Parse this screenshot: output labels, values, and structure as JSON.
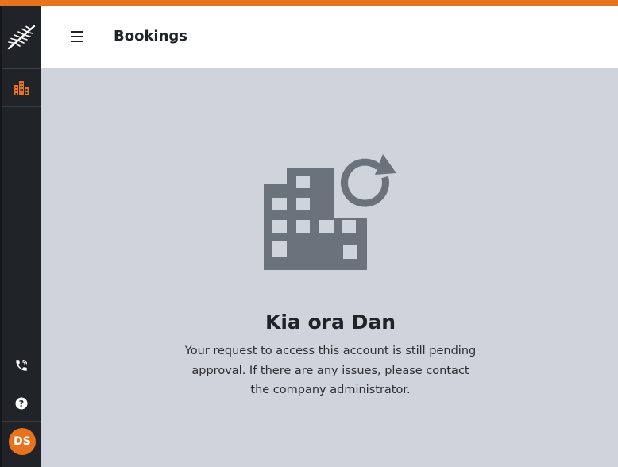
{
  "header": {
    "title": "Bookings"
  },
  "user": {
    "initials": "DS"
  },
  "colors": {
    "accent": "#e8731e",
    "sidebar": "#202327",
    "background": "#cfd3dc",
    "icon": "#6c727b"
  },
  "sidebar": {
    "items": [
      {
        "icon": "building-icon",
        "active": true
      },
      {
        "icon": "phone-icon"
      },
      {
        "icon": "help-icon"
      }
    ]
  },
  "main": {
    "icon": "building-refresh-icon",
    "greeting": "Kia ora Dan",
    "message": "Your request to access this account is still pending approval. If there are any issues, please contact the company administrator."
  }
}
